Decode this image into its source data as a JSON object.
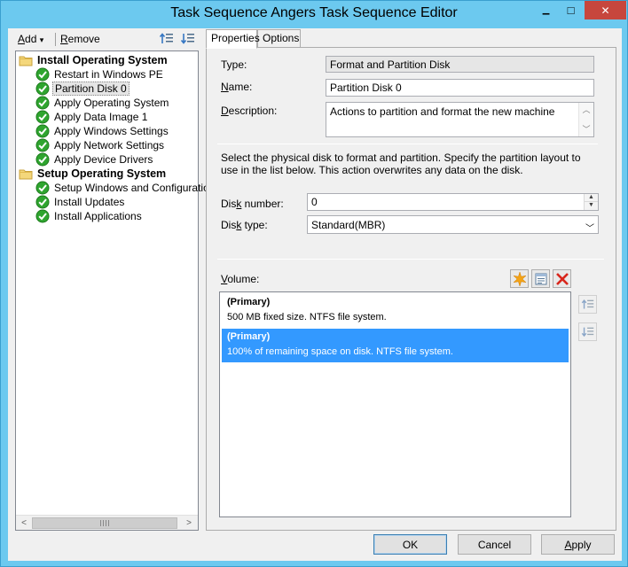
{
  "window": {
    "title": "Task Sequence Angers Task Sequence Editor",
    "controls": {
      "minimize": "▁",
      "maximize": "□",
      "close": "✕"
    }
  },
  "toolbar": {
    "add_label": "Add",
    "add_accel": "A",
    "add_rest": "dd",
    "add_arrow": "▾",
    "remove_label": "Remove",
    "remove_accel": "R",
    "remove_rest": "emove"
  },
  "tree": {
    "groups": [
      {
        "label": "Install Operating System"
      },
      {
        "label": "Setup Operating System"
      }
    ],
    "items": [
      {
        "label": "Restart in Windows PE"
      },
      {
        "label": "Partition Disk 0"
      },
      {
        "label": "Apply Operating System"
      },
      {
        "label": "Apply Data Image 1"
      },
      {
        "label": "Apply Windows Settings"
      },
      {
        "label": "Apply Network Settings"
      },
      {
        "label": "Apply Device Drivers"
      },
      {
        "label": "Setup Windows and Configuration"
      },
      {
        "label": "Install Updates"
      },
      {
        "label": "Install Applications"
      }
    ],
    "scroll": {
      "left": "<",
      "right": ">"
    }
  },
  "tabs": [
    {
      "label": "Properties"
    },
    {
      "label": "Options"
    }
  ],
  "properties": {
    "type_label": "Type:",
    "type_value": "Format and Partition Disk",
    "name_label_accel": "N",
    "name_label_rest": "ame:",
    "name_value": "Partition Disk 0",
    "description_label_accel": "D",
    "description_label_rest": "escription:",
    "description_value": "Actions to partition and format the new machine",
    "info_text": "Select the physical disk to format and partition. Specify the partition layout to use in the list below. This action overwrites any data on the disk.",
    "disk_number_label_pre": "Dis",
    "disk_number_label_accel": "k",
    "disk_number_label_rest": " number:",
    "disk_number_value": "0",
    "disk_type_label_pre": "Dis",
    "disk_type_label_accel": "k",
    "disk_type_label_rest": " type:",
    "disk_type_value": "Standard(MBR)",
    "volume_label_accel": "V",
    "volume_label_rest": "olume:",
    "volumes": [
      {
        "title": "(Primary)",
        "desc": "500 MB fixed size. NTFS file system."
      },
      {
        "title": "(Primary)",
        "desc": "100% of remaining space on disk. NTFS file system."
      }
    ]
  },
  "buttons": {
    "ok": "OK",
    "cancel": "Cancel",
    "apply_accel": "A",
    "apply_rest": "pply"
  },
  "colors": {
    "titlebar": "#6cc9ef",
    "close": "#c7463d",
    "selection": "#3399ff",
    "check": "#2fa52f"
  }
}
